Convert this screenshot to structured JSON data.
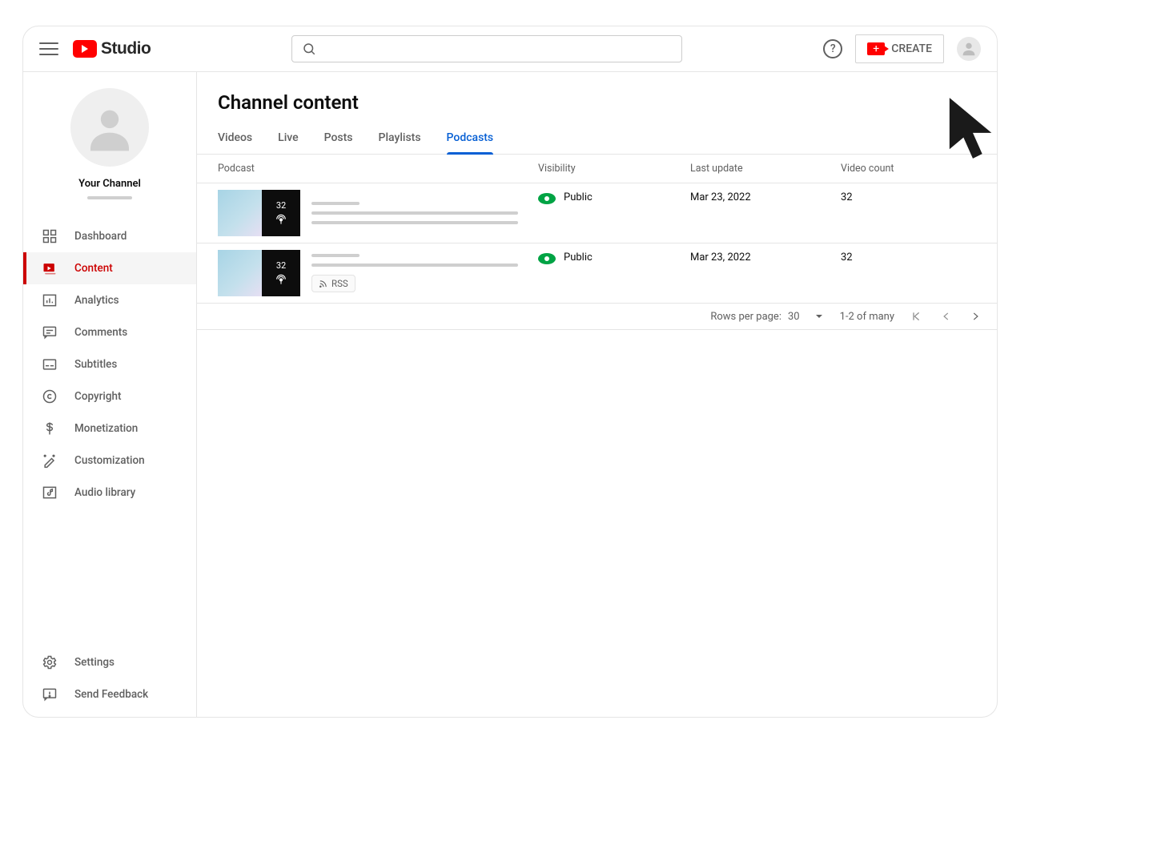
{
  "header": {
    "brand_word": "Studio",
    "search_placeholder": "",
    "create_label": "CREATE",
    "help_label": "?"
  },
  "sidebar": {
    "channel_name": "Your Channel",
    "items": [
      {
        "label": "Dashboard"
      },
      {
        "label": "Content"
      },
      {
        "label": "Analytics"
      },
      {
        "label": "Comments"
      },
      {
        "label": "Subtitles"
      },
      {
        "label": "Copyright"
      },
      {
        "label": "Monetization"
      },
      {
        "label": "Customization"
      },
      {
        "label": "Audio library"
      }
    ],
    "bottom": [
      {
        "label": "Settings"
      },
      {
        "label": "Send Feedback"
      }
    ]
  },
  "main": {
    "title": "Channel content",
    "tabs": [
      {
        "label": "Videos"
      },
      {
        "label": "Live"
      },
      {
        "label": "Posts"
      },
      {
        "label": "Playlists"
      },
      {
        "label": "Podcasts"
      }
    ],
    "active_tab_index": 4,
    "columns": {
      "podcast": "Podcast",
      "visibility": "Visibility",
      "last_update": "Last update",
      "video_count": "Video count"
    },
    "rows": [
      {
        "episode_count": "32",
        "visibility": "Public",
        "last_update": "Mar 23, 2022",
        "video_count": "32",
        "has_rss": false
      },
      {
        "episode_count": "32",
        "visibility": "Public",
        "last_update": "Mar 23, 2022",
        "video_count": "32",
        "has_rss": true,
        "rss_label": "RSS"
      }
    ],
    "pager": {
      "rows_per_page_label": "Rows per page:",
      "rows_per_page_value": "30",
      "range_text": "1-2 of many"
    }
  }
}
